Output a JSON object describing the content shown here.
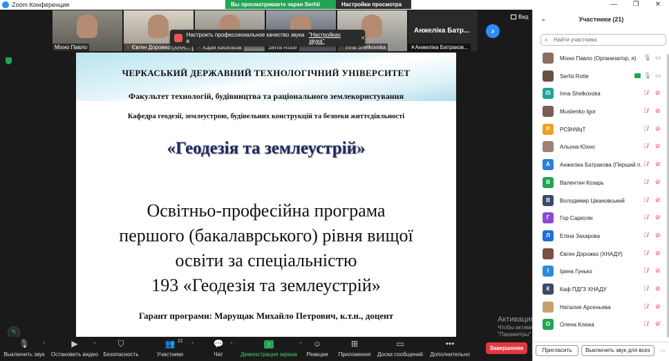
{
  "window": {
    "title": "Zoom Конференция",
    "controls": [
      "—",
      "❐",
      "✕"
    ]
  },
  "share_banner": {
    "viewing": "Вы просматриваете экран Serhii Rotte",
    "settings": "Настройки просмотра ⌄"
  },
  "thumbnails": [
    {
      "name": "Міхно Павло"
    },
    {
      "name": "Євген Дорожко (ХНА..."
    },
    {
      "name": "Юрій Кисельов"
    },
    {
      "name": "Serhii Rotte"
    },
    {
      "name": "Inna Shelkovska"
    },
    {
      "name": "Анжеліка Батраков...",
      "big": "Анжеліка Батр..."
    }
  ],
  "toast": {
    "text": "Настроить профессиональное качество звука в",
    "link": "\"Настройках звука\"",
    "close": "×"
  },
  "view_button": {
    "label": "Вид"
  },
  "next_button": {
    "icon": "›"
  },
  "slide": {
    "university": "ЧЕРКАСЬКИЙ  ДЕРЖАВНИЙ  ТЕХНОЛОГІЧНИЙ  УНІВЕРСИТЕТ",
    "faculty": "Факультет технологій, будівництва та раціонального землекористування",
    "department": "Кафедра геодезії, землеустрою, будівельних конструкцій та безпеки життєдіяльності",
    "specialty": "«Геодезія та землеустрій»",
    "program_line1": "Освітньо-професійна програма",
    "program_line2": "першого (бакалаврського) рівня вищої",
    "program_line3": "освіти за спеціальністю",
    "program_line4": "193 «Геодезія та землеустрій»",
    "guarantor": "Гарант програми: Марущак Михайло Петрович, к.т.н., доцент"
  },
  "watermark": {
    "line1": "Активация Windows",
    "line2": "Чтобы активировать Windows, перейдите в раздел",
    "line3": "\"Параметры\""
  },
  "toolbar": {
    "mute": "Выключить звук",
    "video": "Остановить видео",
    "security": "Безопасность",
    "participants": "Участники",
    "participants_count": "21",
    "chat": "Чат",
    "share": "Демонстрация экрана",
    "reactions": "Реакции",
    "apps": "Приложения",
    "whiteboards": "Доски сообщений",
    "more": "Дополнительно",
    "end": "Завершение"
  },
  "panel": {
    "title": "Участники (21)",
    "search_placeholder": "Найти участника",
    "invite": "Пригласить",
    "mute_all": "Выключить звук для всех",
    "more": "..."
  },
  "participants": [
    {
      "name": "Міхно Павло (Организатор, я)",
      "avatar": "",
      "color": "#8a7060",
      "mic": "on",
      "cam": "on"
    },
    {
      "name": "Serhii Rotte",
      "avatar": "",
      "color": "#6a5040",
      "mic": "on",
      "cam": "on",
      "sharing": true
    },
    {
      "name": "Inna Shelkovska",
      "avatar": "IS",
      "color": "#1fa39a",
      "mic": "off",
      "cam": "off"
    },
    {
      "name": "Musiienko Igor",
      "avatar": "",
      "color": "#7a6050",
      "mic": "off",
      "cam": "off"
    },
    {
      "name": "PC9hNfqT",
      "avatar": "P",
      "color": "#f0a020",
      "mic": "off",
      "cam": "off"
    },
    {
      "name": "Альона Юхно",
      "avatar": "",
      "color": "#a08070",
      "mic": "off",
      "cam": "off"
    },
    {
      "name": "Анжеліка Батракова (Перший п...",
      "avatar": "А",
      "color": "#2d7fd8",
      "mic": "off",
      "cam": "off"
    },
    {
      "name": "Валентин Козарь",
      "avatar": "В",
      "color": "#23a455",
      "mic": "off",
      "cam": "off"
    },
    {
      "name": "Володимир Цікановський",
      "avatar": "В",
      "color": "#3a4a6a",
      "mic": "off",
      "cam": "off"
    },
    {
      "name": "Гор Саркісян",
      "avatar": "Г",
      "color": "#8a4ad8",
      "mic": "off",
      "cam": "off"
    },
    {
      "name": "Еліна Захарова",
      "avatar": "Л",
      "color": "#1f6fd8",
      "mic": "off",
      "cam": "off"
    },
    {
      "name": "Євген Дорожко (ХНАДУ)",
      "avatar": "",
      "color": "#7a5040",
      "mic": "off",
      "cam": "off"
    },
    {
      "name": "Ірина Гунько",
      "avatar": "І",
      "color": "#2d8cd8",
      "mic": "off",
      "cam": "off"
    },
    {
      "name": "Каф ПДГЗ ХНАДУ",
      "avatar": "К",
      "color": "#3a4a6a",
      "mic": "off",
      "cam": "off"
    },
    {
      "name": "Наталия Арсеньева",
      "avatar": "",
      "color": "#c8a070",
      "mic": "off",
      "cam": "off"
    },
    {
      "name": "Олена Клюка",
      "avatar": "О",
      "color": "#23a455",
      "mic": "off",
      "cam": "off"
    }
  ],
  "colors": {
    "accent": "#2d8cff",
    "share_green": "#23a455",
    "end_red": "#e0383e",
    "muted_red": "#e0383e"
  }
}
